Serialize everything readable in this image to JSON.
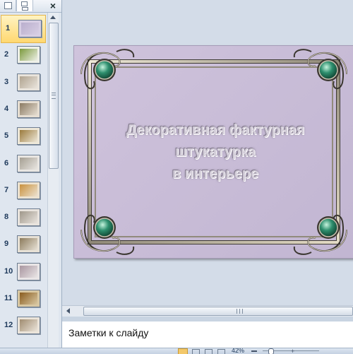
{
  "thumb_pane": {
    "close_glyph": "×",
    "slides": [
      {
        "number": "1",
        "active": true,
        "bg": "#d8cfe4",
        "fill": "#b9aecd"
      },
      {
        "number": "2",
        "active": false,
        "bg": "#eef0e8",
        "fill": "#7b9a3c"
      },
      {
        "number": "3",
        "active": false,
        "bg": "#e9e4dc",
        "fill": "#b0a38f"
      },
      {
        "number": "4",
        "active": false,
        "bg": "#e6ded2",
        "fill": "#8a7a62"
      },
      {
        "number": "5",
        "active": false,
        "bg": "#ede7d8",
        "fill": "#9a7a3c"
      },
      {
        "number": "6",
        "active": false,
        "bg": "#e9e6e2",
        "fill": "#a59f92"
      },
      {
        "number": "7",
        "active": false,
        "bg": "#ece2d0",
        "fill": "#c9913e"
      },
      {
        "number": "8",
        "active": false,
        "bg": "#e9e4de",
        "fill": "#9f978a"
      },
      {
        "number": "9",
        "active": false,
        "bg": "#e7e1d6",
        "fill": "#8c7b5c"
      },
      {
        "number": "10",
        "active": false,
        "bg": "#e9e5e6",
        "fill": "#a996a0"
      },
      {
        "number": "11",
        "active": false,
        "bg": "#d8c7a2",
        "fill": "#8a5c1e"
      },
      {
        "number": "12",
        "active": false,
        "bg": "#ebe4da",
        "fill": "#a08c70"
      }
    ]
  },
  "slide": {
    "title": "Декоративная фактурная\nштукатурка\nв интерьере",
    "background": "#c9bdd8",
    "gem_color": "#2e8f6e"
  },
  "notes": {
    "placeholder": "Заметки к слайду"
  },
  "status_bar": {
    "zoom": "42%"
  }
}
